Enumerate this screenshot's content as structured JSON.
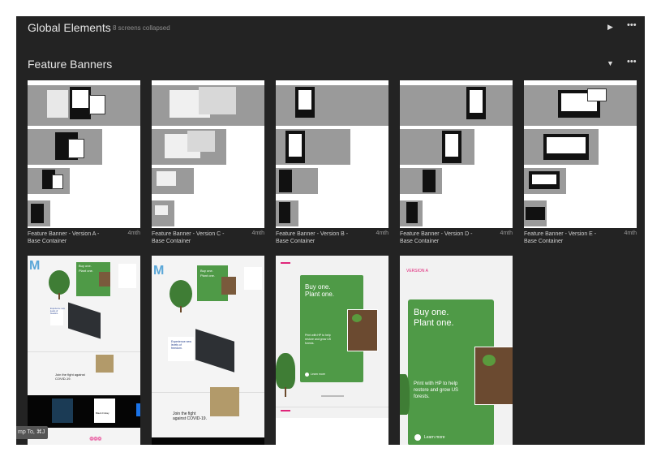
{
  "global_section": {
    "title": "Global Elements",
    "subtitle": "8 screens collapsed",
    "toggle_icon": "play-right-icon",
    "more_icon": "more-icon"
  },
  "feature_section": {
    "title": "Feature Banners",
    "toggle_icon": "caret-down-icon",
    "more_icon": "more-icon"
  },
  "cards": [
    {
      "name": "Feature Banner - Version A - Base Container",
      "age": "4mth"
    },
    {
      "name": "Feature Banner - Version C - Base Container",
      "age": "4mth"
    },
    {
      "name": "Feature Banner - Version B - Base Container",
      "age": "4mth"
    },
    {
      "name": "Feature Banner - Version D - Base Container",
      "age": "4mth"
    },
    {
      "name": "Feature Banner - Version E - Base Container",
      "age": "4mth"
    }
  ],
  "previews": {
    "buy_one": "Buy one.",
    "plant_one": "Plant one.",
    "print_text": "Print with HP to help restore and grow US forests.",
    "learn_more": "Learn more",
    "version_label": "VERSION A",
    "fight_text": "Join the fight against COVID-19.",
    "experience_text": "Experience new levels of freedom.",
    "black_friday": "Black Friday"
  },
  "tooltip": "mp To, ⌘J",
  "colors": {
    "background": "#232323",
    "accent": "#e0267a",
    "green": "#4f9a47"
  }
}
